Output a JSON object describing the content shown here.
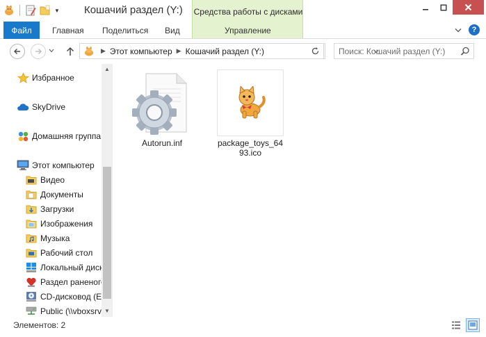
{
  "window": {
    "title": "Кошачий раздел (Y:)",
    "context_tab_title": "Средства работы с дисками",
    "close_color": "#c75050"
  },
  "ribbon": {
    "tabs": [
      {
        "label": "Файл",
        "active": true,
        "color": "#1979ca"
      },
      {
        "label": "Главная"
      },
      {
        "label": "Поделиться"
      },
      {
        "label": "Вид"
      },
      {
        "label": "Управление"
      }
    ],
    "help_label": "?"
  },
  "navigation": {
    "breadcrumb": [
      "Этот компьютер",
      "Кошачий раздел (Y:)"
    ],
    "search_placeholder": "Поиск: Кошачий раздел (Y:)"
  },
  "sidebar": {
    "groups": [
      {
        "label": "Избранное",
        "icon": "star-icon"
      },
      {
        "label": "SkyDrive",
        "icon": "cloud-icon"
      },
      {
        "label": "Домашняя группа",
        "icon": "homegroup-icon"
      },
      {
        "label": "Этот компьютер",
        "icon": "computer-icon"
      }
    ],
    "items": [
      {
        "label": "Видео",
        "icon": "video-folder-icon"
      },
      {
        "label": "Документы",
        "icon": "documents-folder-icon"
      },
      {
        "label": "Загрузки",
        "icon": "downloads-folder-icon"
      },
      {
        "label": "Изображения",
        "icon": "pictures-folder-icon"
      },
      {
        "label": "Музыка",
        "icon": "music-folder-icon"
      },
      {
        "label": "Рабочий стол",
        "icon": "desktop-folder-icon"
      },
      {
        "label": "Локальный диск",
        "icon": "windows-drive-icon"
      },
      {
        "label": "Раздел раненого",
        "icon": "heart-drive-icon"
      },
      {
        "label": "CD-дисковод (E:",
        "icon": "cd-drive-icon"
      },
      {
        "label": "Public (\\\\vboxsrv",
        "icon": "network-drive-icon"
      }
    ]
  },
  "files": [
    {
      "name": "Autorun.inf",
      "icon": "settings-file-icon"
    },
    {
      "name": "package_toys_6493.ico",
      "icon": "cat-icon"
    }
  ],
  "status": {
    "count_text": "Элементов: 2"
  }
}
